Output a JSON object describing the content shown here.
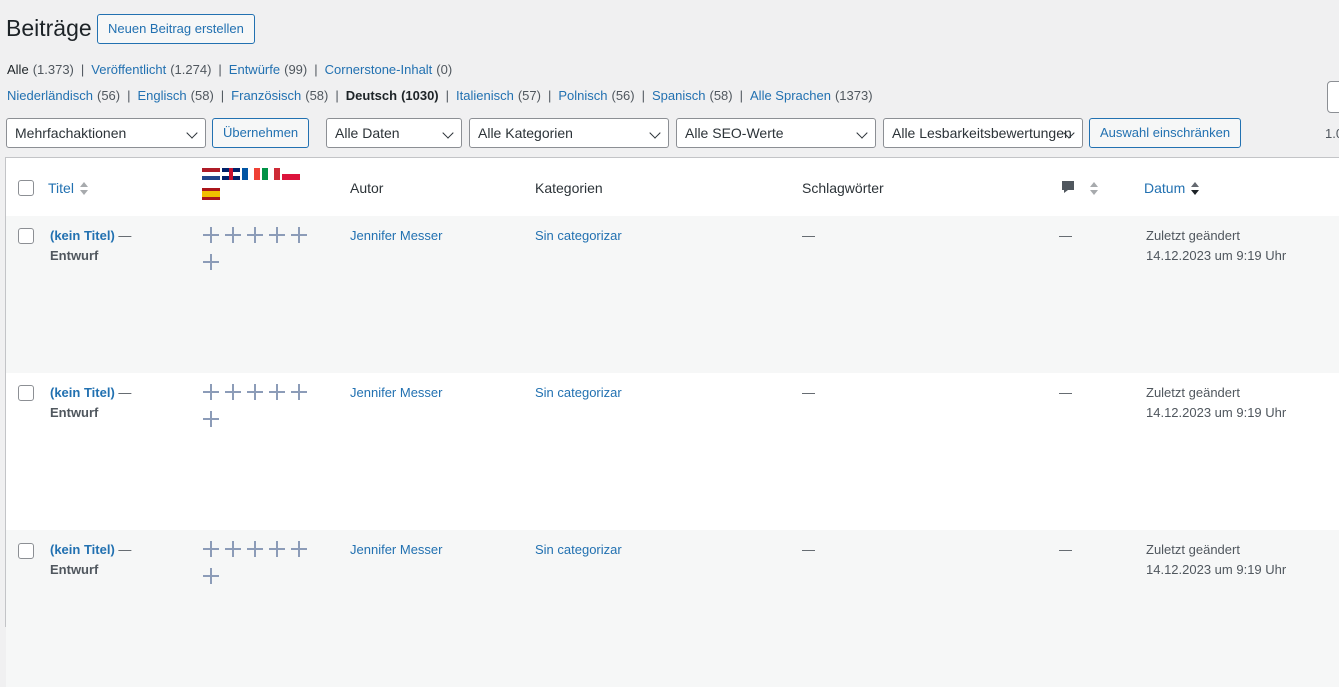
{
  "page": {
    "title": "Beiträge",
    "add_new_label": "Neuen Beitrag erstellen"
  },
  "status_filters": [
    {
      "label": "Alle",
      "count": "(1.373)",
      "current": true
    },
    {
      "label": "Veröffentlicht",
      "count": "(1.274)"
    },
    {
      "label": "Entwürfe",
      "count": "(99)"
    },
    {
      "label": "Cornerstone-Inhalt",
      "count": "(0)"
    }
  ],
  "language_filters": [
    {
      "label": "Niederländisch",
      "count": "(56)"
    },
    {
      "label": "Englisch",
      "count": "(58)"
    },
    {
      "label": "Französisch",
      "count": "(58)"
    },
    {
      "label": "Deutsch",
      "count": "(1030)",
      "current": true
    },
    {
      "label": "Italienisch",
      "count": "(57)"
    },
    {
      "label": "Polnisch",
      "count": "(56)"
    },
    {
      "label": "Spanisch",
      "count": "(58)"
    },
    {
      "label": "Alle Sprachen",
      "count": "(1373)"
    }
  ],
  "toolbar": {
    "bulk_actions": "Mehrfachaktionen",
    "apply": "Übernehmen",
    "dates": "Alle Daten",
    "categories": "Alle Kategorien",
    "seo": "Alle SEO-Werte",
    "readability": "Alle Lesbarkeitsbewertungen",
    "filter": "Auswahl einschränken",
    "pagination_partial": "1.0"
  },
  "columns": {
    "title": "Titel",
    "author": "Autor",
    "categories": "Kategorien",
    "tags": "Schlagwörter",
    "date": "Datum",
    "languages": [
      "nl",
      "gb",
      "fr",
      "it",
      "pl",
      "es"
    ]
  },
  "rows": [
    {
      "title": "(kein Titel)",
      "dash": " —",
      "state": "Entwurf",
      "author": "Jennifer Messer",
      "category": "Sin categorizar",
      "tags": "—",
      "comments": "—",
      "date_status": "Zuletzt geändert",
      "date": "14.12.2023 um 9:19 Uhr"
    },
    {
      "title": "(kein Titel)",
      "dash": " —",
      "state": "Entwurf",
      "author": "Jennifer Messer",
      "category": "Sin categorizar",
      "tags": "—",
      "comments": "—",
      "date_status": "Zuletzt geändert",
      "date": "14.12.2023 um 9:19 Uhr"
    },
    {
      "title": "(kein Titel)",
      "dash": " —",
      "state": "Entwurf",
      "author": "Jennifer Messer",
      "category": "Sin categorizar",
      "tags": "—",
      "comments": "—",
      "date_status": "Zuletzt geändert",
      "date": "14.12.2023 um 9:19 Uhr"
    }
  ],
  "icons": {
    "comment": "comment-bubble-icon",
    "add_translation": "plus-icon",
    "sort": "sort-arrows-icon"
  }
}
